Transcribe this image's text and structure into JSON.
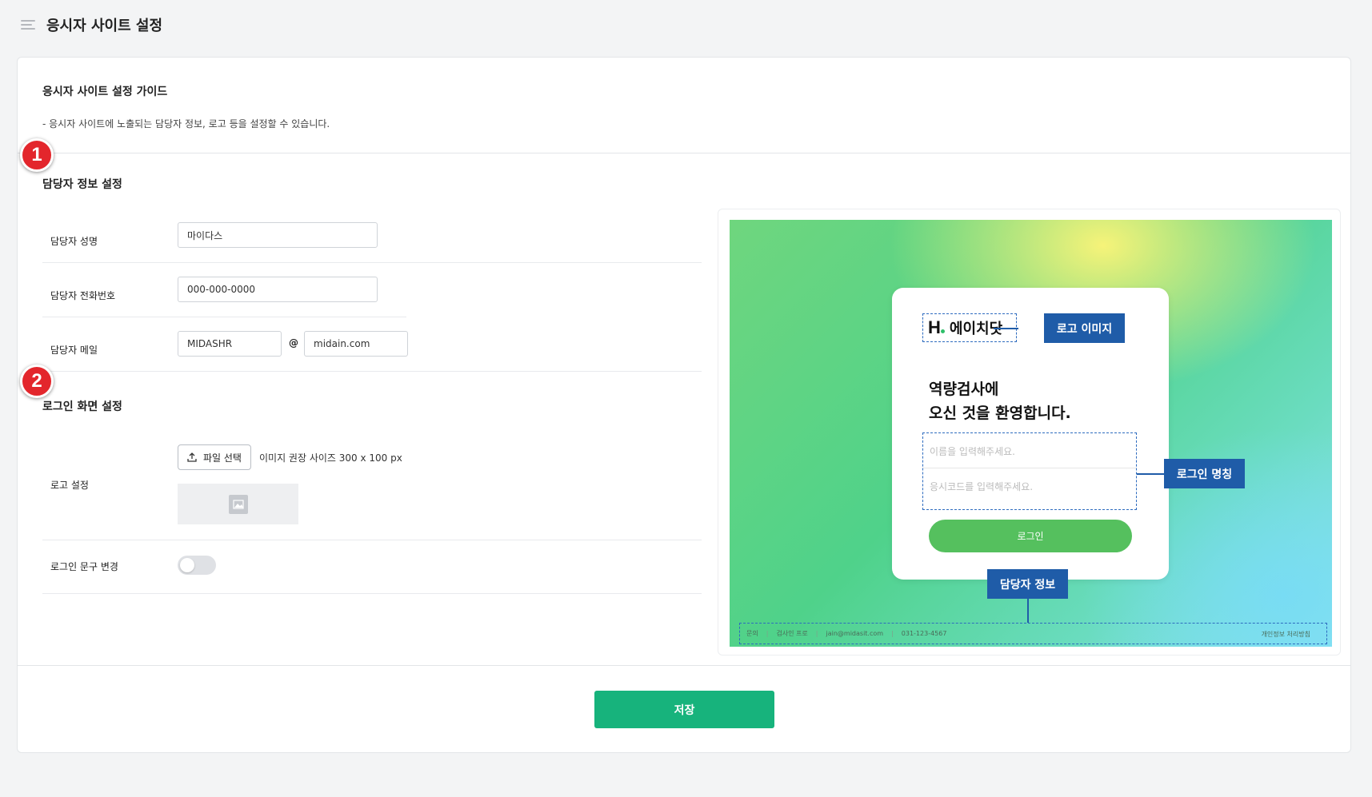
{
  "header": {
    "title": "응시자 사이트 설정"
  },
  "guide": {
    "title": "응시자 사이트 설정 가이드",
    "description": "- 응시자 사이트에 노출되는 담당자 정보, 로고 등을 설정할 수 있습니다."
  },
  "badges": [
    "1",
    "2"
  ],
  "contact_section": {
    "title": "담당자 정보 설정",
    "name_label": "담당자 성명",
    "name_value": "마이다스",
    "phone_label": "담당자 전화번호",
    "phone_value": "000-000-0000",
    "email_label": "담당자 메일",
    "email_user": "MIDASHR",
    "email_at": "@",
    "email_domain": "midain.com"
  },
  "login_section": {
    "title": "로그인 화면 설정",
    "logo_label": "로고 설정",
    "file_button": "파일 선택",
    "file_hint": "이미지 권장 사이즈 300 x 100 px",
    "phrase_label": "로그인 문구 변경",
    "phrase_toggle_on": false
  },
  "preview": {
    "brand_mark": "H",
    "brand_name": "에이치닷",
    "welcome_line1": "역량검사에",
    "welcome_line2": "오신 것을 환영합니다.",
    "name_placeholder": "이름을 입력해주세요.",
    "code_placeholder": "응시코드를 입력해주세요.",
    "login_button": "로그인",
    "callout_logo": "로고 이미지",
    "callout_login": "로그인 명칭",
    "callout_contact": "담당자 정보",
    "footer": {
      "inquiry": "문의",
      "manager": "검사인 프로",
      "email": "jain@midasit.com",
      "phone": "031-123-4567",
      "privacy": "개인정보 처리방침"
    },
    "colors": {
      "callout": "#1f5ca8",
      "login_button": "#55c05e"
    }
  },
  "save_button": "저장",
  "colors": {
    "accent": "#17b37c",
    "badge": "#e3262c"
  }
}
